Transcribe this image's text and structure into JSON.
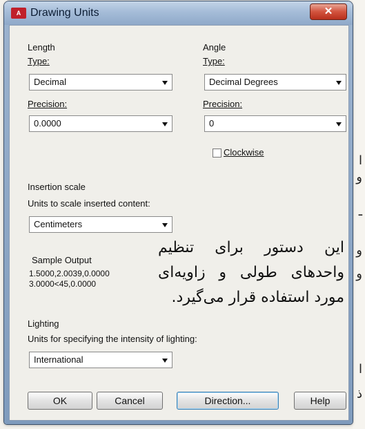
{
  "window": {
    "title": "Drawing Units",
    "app_icon": "A"
  },
  "length": {
    "group_label": "Length",
    "type_label": "Type:",
    "type_value": "Decimal",
    "precision_label": "Precision:",
    "precision_value": "0.0000"
  },
  "angle": {
    "group_label": "Angle",
    "type_label": "Type:",
    "type_value": "Decimal Degrees",
    "precision_label": "Precision:",
    "precision_value": "0",
    "clockwise_label": "Clockwise",
    "clockwise_checked": false
  },
  "insertion": {
    "group_label": "Insertion scale",
    "units_label": "Units to scale inserted content:",
    "units_value": "Centimeters"
  },
  "sample_output": {
    "label": "Sample Output",
    "line1": "1.5000,2.0039,0.0000",
    "line2": "3.0000<45,0.0000"
  },
  "lighting": {
    "group_label": "Lighting",
    "units_label": "Units for specifying the intensity of lighting:",
    "units_value": "International"
  },
  "buttons": {
    "ok": "OK",
    "cancel": "Cancel",
    "direction": "Direction...",
    "help": "Help"
  },
  "overlay_text": "این دستور برای تنظیم واحدهای طولی و زاویه‌ای مورد استفاده قرار می‌گیرد.",
  "edge_glyphs": [
    "ا",
    "و",
    "ـ",
    "و",
    "و",
    "ا",
    "ذ"
  ]
}
